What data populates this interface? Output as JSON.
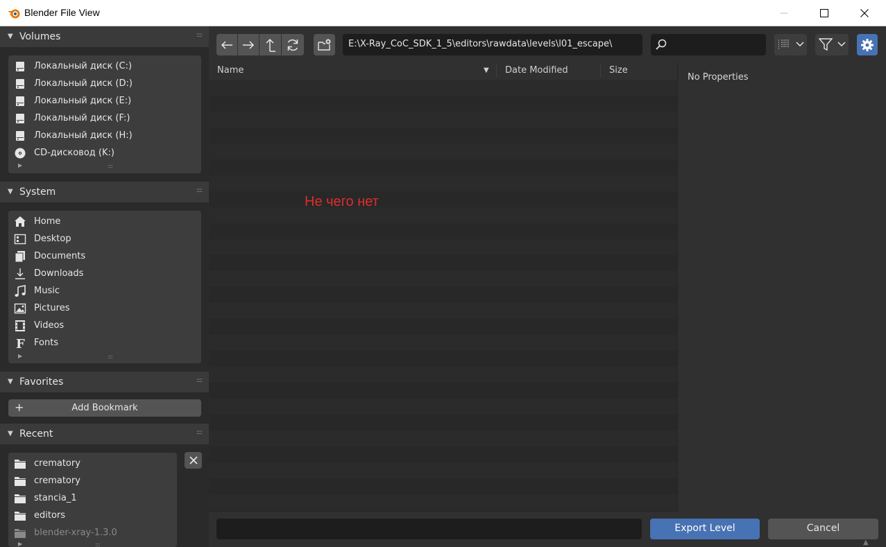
{
  "window": {
    "title": "Blender File View"
  },
  "sidebar": {
    "volumes": {
      "header": "Volumes",
      "items": [
        {
          "label": "Локальный диск (C:)",
          "icon": "disk-icon"
        },
        {
          "label": "Локальный диск (D:)",
          "icon": "disk-icon"
        },
        {
          "label": "Локальный диск (E:)",
          "icon": "disk-icon"
        },
        {
          "label": "Локальный диск (F:)",
          "icon": "disk-icon"
        },
        {
          "label": "Локальный диск (H:)",
          "icon": "disk-icon"
        },
        {
          "label": "CD-дисковод (K:)",
          "icon": "cd-icon"
        }
      ]
    },
    "system": {
      "header": "System",
      "items": [
        {
          "label": "Home",
          "icon": "home-icon"
        },
        {
          "label": "Desktop",
          "icon": "desktop-icon"
        },
        {
          "label": "Documents",
          "icon": "documents-icon"
        },
        {
          "label": "Downloads",
          "icon": "downloads-icon"
        },
        {
          "label": "Music",
          "icon": "music-icon"
        },
        {
          "label": "Pictures",
          "icon": "pictures-icon"
        },
        {
          "label": "Videos",
          "icon": "videos-icon"
        },
        {
          "label": "Fonts",
          "icon": "fonts-icon"
        }
      ]
    },
    "favorites": {
      "header": "Favorites",
      "add_bookmark_label": "Add Bookmark"
    },
    "recent": {
      "header": "Recent",
      "items": [
        {
          "label": "crematory",
          "icon": "folder-icon"
        },
        {
          "label": "crematory",
          "icon": "folder-icon"
        },
        {
          "label": "stancia_1",
          "icon": "folder-icon"
        },
        {
          "label": "editors",
          "icon": "folder-icon"
        },
        {
          "label": "blender-xray-1.3.0",
          "icon": "folder-icon"
        }
      ]
    }
  },
  "toolbar": {
    "path": "E:\\X-Ray_CoC_SDK_1_5\\editors\\rawdata\\levels\\l01_escape\\",
    "search_value": ""
  },
  "filelist": {
    "columns": {
      "name": "Name",
      "date_modified": "Date Modified",
      "size": "Size"
    },
    "empty_note": "Не чего нет"
  },
  "properties": {
    "empty_label": "No Properties"
  },
  "bottom": {
    "filename_value": "",
    "export_label": "Export Level",
    "cancel_label": "Cancel"
  },
  "colors": {
    "accent": "#4772b3",
    "note": "#e02c2c",
    "background": "#303030"
  }
}
